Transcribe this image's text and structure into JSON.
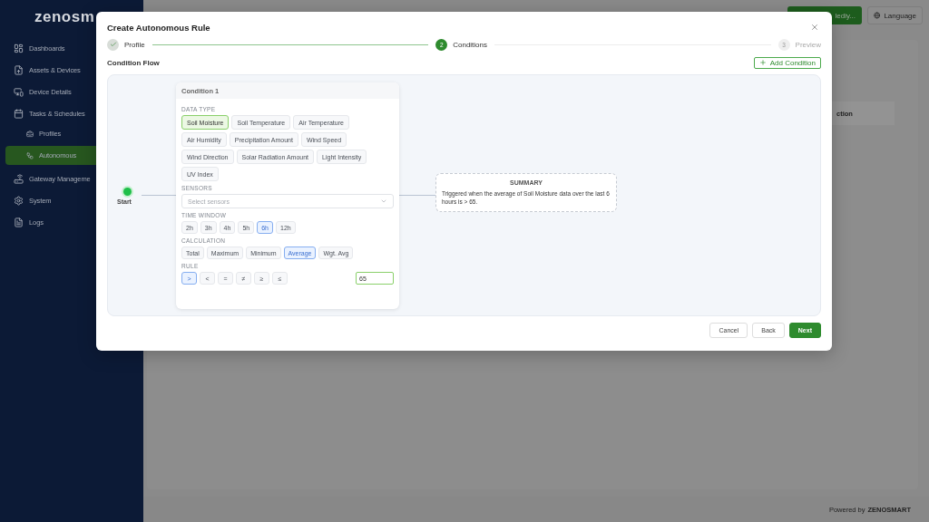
{
  "sidebar": {
    "logo": "zenosm",
    "items": [
      {
        "label": "Dashboards",
        "selected": false
      },
      {
        "label": "Assets & Devices",
        "selected": false
      },
      {
        "label": "Device Details",
        "selected": false
      },
      {
        "label": "Tasks & Schedules",
        "selected": false,
        "children": [
          {
            "label": "Profiles",
            "selected": false
          },
          {
            "label": "Autonomous",
            "selected": true
          }
        ]
      },
      {
        "label": "Gateway Manageme",
        "selected": false
      },
      {
        "label": "System",
        "selected": false
      },
      {
        "label": "Logs",
        "selected": false
      }
    ]
  },
  "top_bar": {
    "buttons": [
      {
        "label": "lediy...",
        "kind": "primary"
      },
      {
        "label": "Language",
        "kind": "outline"
      }
    ]
  },
  "background_table": {
    "column_header": "ction"
  },
  "modal": {
    "title": "Create Autonomous Rule",
    "steps": [
      {
        "label": "Profile",
        "kind": "done"
      },
      {
        "number": "2",
        "label": "Conditions",
        "kind": "active"
      },
      {
        "number": "3",
        "label": "Preview",
        "kind": "pending"
      }
    ],
    "section_title": "Condition Flow",
    "add_button": "Add Condition",
    "flow": {
      "start_label": "Start",
      "condition": {
        "title": "Condition 1",
        "data_type": {
          "label": "DATA TYPE",
          "options": [
            {
              "label": "Soil Moisture",
              "selected": true
            },
            {
              "label": "Soil Temperature",
              "selected": false
            },
            {
              "label": "Air Temperature",
              "selected": false
            },
            {
              "label": "Air Humidity",
              "selected": false
            },
            {
              "label": "Precipitation Amount",
              "selected": false
            },
            {
              "label": "Wind Speed",
              "selected": false
            },
            {
              "label": "Wind Direction",
              "selected": false
            },
            {
              "label": "Solar Radiation Amount",
              "selected": false
            },
            {
              "label": "Light Intensity",
              "selected": false
            },
            {
              "label": "UV Index",
              "selected": false
            }
          ]
        },
        "sensors": {
          "label": "SENSORS",
          "placeholder": "Select sensors"
        },
        "time_window": {
          "label": "TIME WINDOW",
          "options": [
            {
              "label": "2h",
              "selected": false
            },
            {
              "label": "3h",
              "selected": false
            },
            {
              "label": "4h",
              "selected": false
            },
            {
              "label": "5h",
              "selected": false
            },
            {
              "label": "6h",
              "selected": true
            },
            {
              "label": "12h",
              "selected": false
            }
          ]
        },
        "calculation": {
          "label": "CALCULATION",
          "options": [
            {
              "label": "Total",
              "selected": false
            },
            {
              "label": "Maximum",
              "selected": false
            },
            {
              "label": "Minimum",
              "selected": false
            },
            {
              "label": "Average",
              "selected": true
            },
            {
              "label": "Wgt. Avg",
              "selected": false
            }
          ]
        },
        "rule": {
          "label": "RULE",
          "operators": [
            {
              "label": ">",
              "selected": true
            },
            {
              "label": "<",
              "selected": false
            },
            {
              "label": "=",
              "selected": false
            },
            {
              "label": "≠",
              "selected": false
            },
            {
              "label": "≥",
              "selected": false
            },
            {
              "label": "≤",
              "selected": false
            }
          ],
          "value": "65"
        }
      },
      "summary": {
        "title": "SUMMARY",
        "text": "Triggered when the average of Soil Moisture data over the last 6 hours is > 65."
      }
    },
    "buttons": [
      {
        "label": "Cancel",
        "kind": "default"
      },
      {
        "label": "Back",
        "kind": "default"
      },
      {
        "label": "Next",
        "kind": "primary"
      }
    ]
  },
  "footer": {
    "text": "Powered by",
    "brand": "ZENOSMART"
  }
}
